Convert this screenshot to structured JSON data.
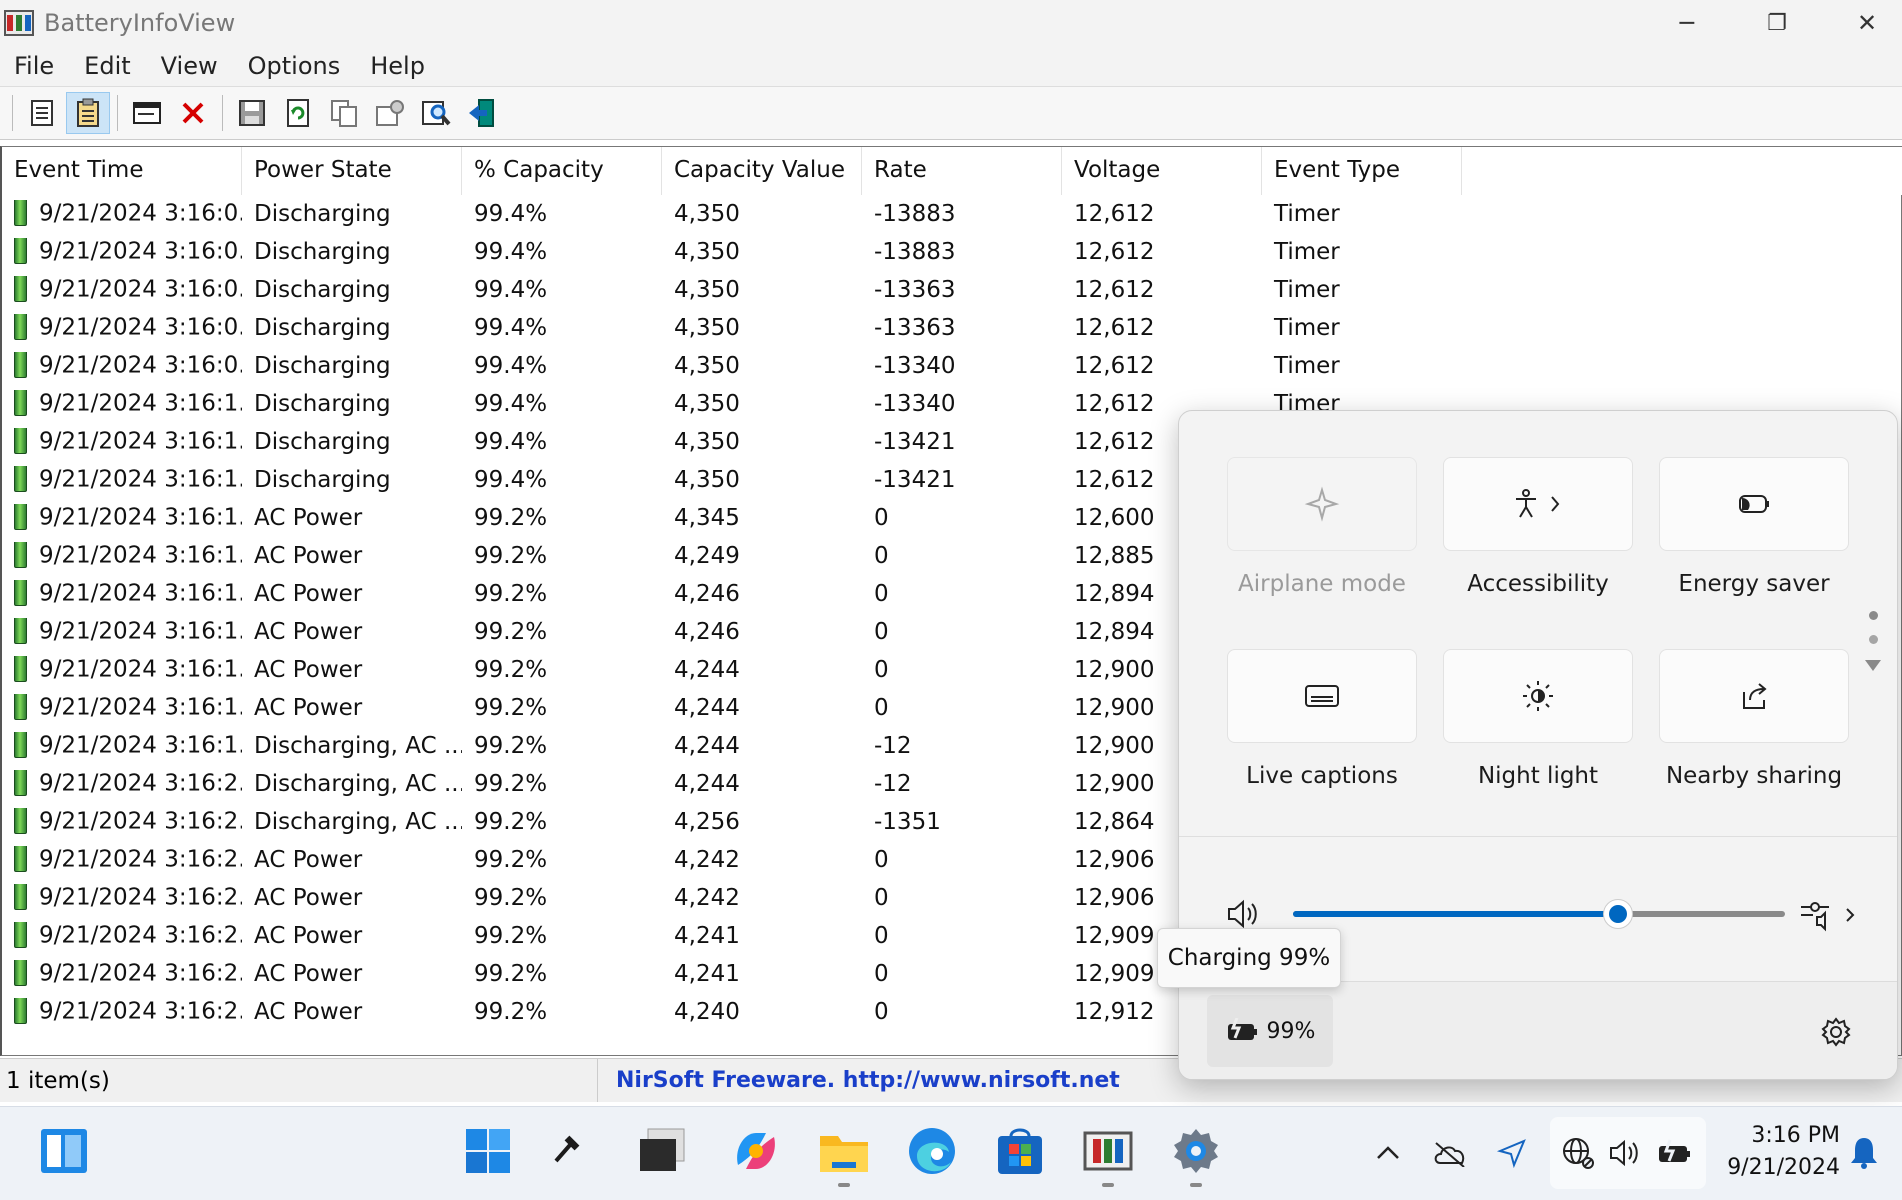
{
  "window": {
    "title": "BatteryInfoView",
    "minimize": "─",
    "restore": "❐",
    "close": "✕"
  },
  "menu": [
    "File",
    "Edit",
    "View",
    "Options",
    "Help"
  ],
  "toolbar_icons": [
    "properties-icon",
    "clipboard-icon",
    "window-icon",
    "delete-icon",
    "save-icon",
    "refresh-icon",
    "copy-icon",
    "options-icon",
    "find-icon",
    "exit-icon"
  ],
  "table": {
    "columns": [
      "Event Time",
      "Power State",
      "% Capacity",
      "Capacity Value",
      "Rate",
      "Voltage",
      "Event Type"
    ],
    "rows": [
      [
        "9/21/2024 3:16:0...",
        "Discharging",
        "99.4%",
        "4,350",
        "-13883",
        "12,612",
        "Timer"
      ],
      [
        "9/21/2024 3:16:0...",
        "Discharging",
        "99.4%",
        "4,350",
        "-13883",
        "12,612",
        "Timer"
      ],
      [
        "9/21/2024 3:16:0...",
        "Discharging",
        "99.4%",
        "4,350",
        "-13363",
        "12,612",
        "Timer"
      ],
      [
        "9/21/2024 3:16:0...",
        "Discharging",
        "99.4%",
        "4,350",
        "-13363",
        "12,612",
        "Timer"
      ],
      [
        "9/21/2024 3:16:0...",
        "Discharging",
        "99.4%",
        "4,350",
        "-13340",
        "12,612",
        "Timer"
      ],
      [
        "9/21/2024 3:16:1...",
        "Discharging",
        "99.4%",
        "4,350",
        "-13340",
        "12,612",
        "Timer"
      ],
      [
        "9/21/2024 3:16:1...",
        "Discharging",
        "99.4%",
        "4,350",
        "-13421",
        "12,612",
        ""
      ],
      [
        "9/21/2024 3:16:1...",
        "Discharging",
        "99.4%",
        "4,350",
        "-13421",
        "12,612",
        ""
      ],
      [
        "9/21/2024 3:16:1...",
        "AC Power",
        "99.2%",
        "4,345",
        "0",
        "12,600",
        ""
      ],
      [
        "9/21/2024 3:16:1...",
        "AC Power",
        "99.2%",
        "4,249",
        "0",
        "12,885",
        ""
      ],
      [
        "9/21/2024 3:16:1...",
        "AC Power",
        "99.2%",
        "4,246",
        "0",
        "12,894",
        ""
      ],
      [
        "9/21/2024 3:16:1...",
        "AC Power",
        "99.2%",
        "4,246",
        "0",
        "12,894",
        ""
      ],
      [
        "9/21/2024 3:16:1...",
        "AC Power",
        "99.2%",
        "4,244",
        "0",
        "12,900",
        ""
      ],
      [
        "9/21/2024 3:16:1...",
        "AC Power",
        "99.2%",
        "4,244",
        "0",
        "12,900",
        ""
      ],
      [
        "9/21/2024 3:16:1...",
        "Discharging, AC ...",
        "99.2%",
        "4,244",
        "-12",
        "12,900",
        ""
      ],
      [
        "9/21/2024 3:16:2...",
        "Discharging, AC ...",
        "99.2%",
        "4,244",
        "-12",
        "12,900",
        ""
      ],
      [
        "9/21/2024 3:16:2...",
        "Discharging, AC ...",
        "99.2%",
        "4,256",
        "-1351",
        "12,864",
        ""
      ],
      [
        "9/21/2024 3:16:2...",
        "AC Power",
        "99.2%",
        "4,242",
        "0",
        "12,906",
        ""
      ],
      [
        "9/21/2024 3:16:2...",
        "AC Power",
        "99.2%",
        "4,242",
        "0",
        "12,906",
        ""
      ],
      [
        "9/21/2024 3:16:2...",
        "AC Power",
        "99.2%",
        "4,241",
        "0",
        "12,909",
        ""
      ],
      [
        "9/21/2024 3:16:2...",
        "AC Power",
        "99.2%",
        "4,241",
        "0",
        "12,909",
        ""
      ],
      [
        "9/21/2024 3:16:2...",
        "AC Power",
        "99.2%",
        "4,240",
        "0",
        "12,912",
        ""
      ]
    ]
  },
  "status": {
    "count": "1 item(s)",
    "nirsoft": "NirSoft Freeware.  http://www.nirsoft.net"
  },
  "quick_settings": {
    "tiles": [
      {
        "label": "Airplane mode",
        "icon": "airplane-icon",
        "enabled": false
      },
      {
        "label": "Accessibility",
        "icon": "accessibility-icon",
        "enabled": true
      },
      {
        "label": "Energy saver",
        "icon": "energy-saver-icon",
        "enabled": true
      },
      {
        "label": "Live captions",
        "icon": "captions-icon",
        "enabled": true
      },
      {
        "label": "Night light",
        "icon": "night-light-icon",
        "enabled": true
      },
      {
        "label": "Nearby sharing",
        "icon": "share-icon",
        "enabled": true
      }
    ],
    "volume_level": 0.66,
    "battery_label": "99%"
  },
  "tooltip": "Charging 99%",
  "taskbar": {
    "apps": [
      "widgets-icon",
      "start-icon",
      "tool-icon",
      "terminal-icon",
      "copilot-icon",
      "file-explorer-icon",
      "edge-icon",
      "store-icon",
      "batteryinfoview-icon",
      "settings-icon"
    ],
    "time": "3:16 PM",
    "date": "9/21/2024"
  },
  "colors": {
    "accent": "#0067c0",
    "link": "#1a3fc9",
    "battery_green": "#4caf50"
  }
}
